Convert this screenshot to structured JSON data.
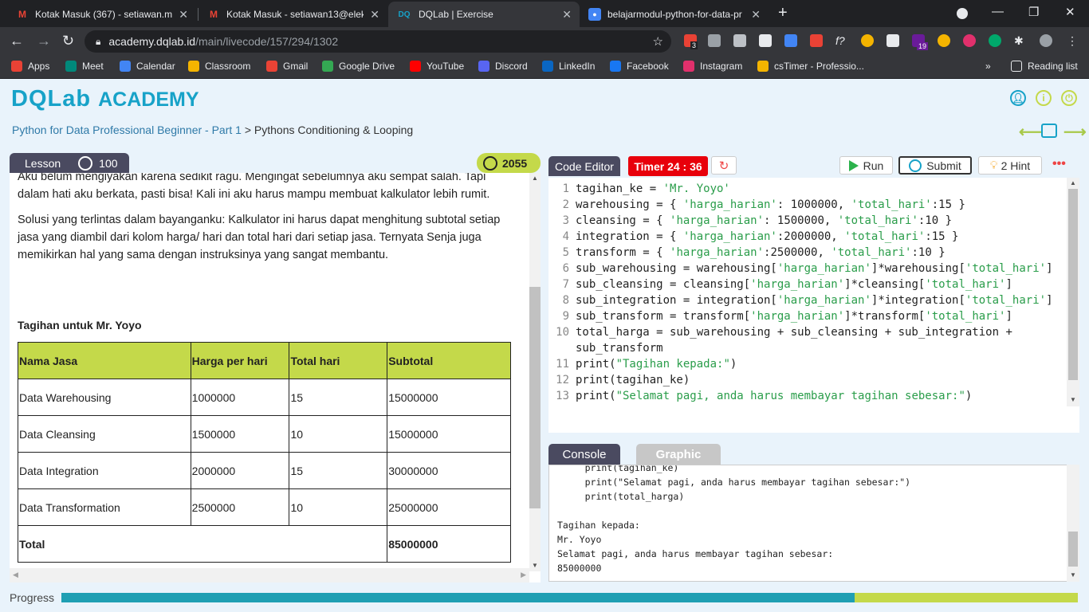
{
  "browser": {
    "tabs": [
      {
        "title": "Kotak Masuk (367) - setiawan.mo",
        "icon": "gmail-icon"
      },
      {
        "title": "Kotak Masuk - setiawan13@elekt",
        "icon": "gmail-icon"
      },
      {
        "title": "DQLab | Exercise",
        "icon": "dqlab-icon"
      },
      {
        "title": "belajarmodul-python-for-data-pr",
        "icon": "site-icon"
      }
    ],
    "favicon_dqlab": "DQ",
    "new_tab": "+",
    "url_host": "academy.dqlab.id",
    "url_path": "/main/livecode/157/294/1302",
    "bookmarks": [
      {
        "label": "Apps",
        "color": "#e94235"
      },
      {
        "label": "Meet",
        "color": "#00897b"
      },
      {
        "label": "Calendar",
        "color": "#4285f4"
      },
      {
        "label": "Classroom",
        "color": "#f4b400"
      },
      {
        "label": "Gmail",
        "color": "#ea4335"
      },
      {
        "label": "Google Drive",
        "color": "#34a853"
      },
      {
        "label": "YouTube",
        "color": "#ff0000"
      },
      {
        "label": "Discord",
        "color": "#5865f2"
      },
      {
        "label": "LinkedIn",
        "color": "#0a66c2"
      },
      {
        "label": "Facebook",
        "color": "#1877f2"
      },
      {
        "label": "Instagram",
        "color": "#e1306c"
      },
      {
        "label": "csTimer - Professio...",
        "color": "#f4b400"
      }
    ],
    "more_bookmarks": "»",
    "reading_list": "Reading list",
    "ext_badge_1": "3",
    "ext_badge_2": "19"
  },
  "header": {
    "logo_dq": "DQLab",
    "logo_academy": "ACADEMY",
    "breadcrumb_course": "Python for Data Professional Beginner - Part 1",
    "breadcrumb_sep": " > ",
    "breadcrumb_chapter": "Pythons Conditioning & Looping"
  },
  "lesson": {
    "tab_label": "Lesson",
    "tab_points": "100",
    "total_points": "2055",
    "paragraphs": [
      "Aku belum mengiyakan karena sedikit ragu. Mengingat sebelumnya aku sempat salah. Tapi dalam hati aku berkata, pasti bisa! Kali ini aku harus mampu membuat kalkulator lebih rumit.",
      "Solusi yang terlintas dalam bayanganku: Kalkulator ini harus dapat menghitung subtotal setiap jasa yang diambil dari kolom harga/ hari dan total hari dari setiap jasa. Ternyata Senja juga memikirkan hal yang sama dengan instruksinya yang sangat membantu."
    ],
    "table_title": "Tagihan untuk Mr. Yoyo",
    "table_headers": [
      "Nama Jasa",
      "Harga per hari",
      "Total hari",
      "Subtotal"
    ],
    "table_rows": [
      [
        "Data Warehousing",
        "1000000",
        "15",
        "15000000"
      ],
      [
        "Data Cleansing",
        "1500000",
        "10",
        "15000000"
      ],
      [
        "Data Integration",
        "2000000",
        "15",
        "30000000"
      ],
      [
        "Data Transformation",
        "2500000",
        "10",
        "25000000"
      ]
    ],
    "total_label": "Total",
    "total_value": "85000000"
  },
  "editor": {
    "tab_label": "Code Editor",
    "timer": "Timer 24 : 36",
    "run_label": "Run",
    "submit_label": "Submit",
    "hint_label": "2 Hint",
    "more_label": "•••"
  },
  "console": {
    "tab_label": "Console",
    "graphic_label": "Graphic",
    "lines": [
      "     print(tagihan_ke)",
      "     print(\"Selamat pagi, anda harus membayar tagihan sebesar:\")",
      "     print(total_harga)",
      "",
      "Tagihan kepada:",
      "Mr. Yoyo",
      "Selamat pagi, anda harus membayar tagihan sebesar:",
      "85000000"
    ]
  },
  "progress": {
    "label": "Progress",
    "percent": 78,
    "fill_color": "#1f9fb3",
    "track_color": "#c4d94a"
  },
  "colors": {
    "accent_lime": "#c4d94a",
    "accent_teal": "#17a2c8",
    "tab_dark": "#4a4a60",
    "timer_red": "#e8000b"
  }
}
